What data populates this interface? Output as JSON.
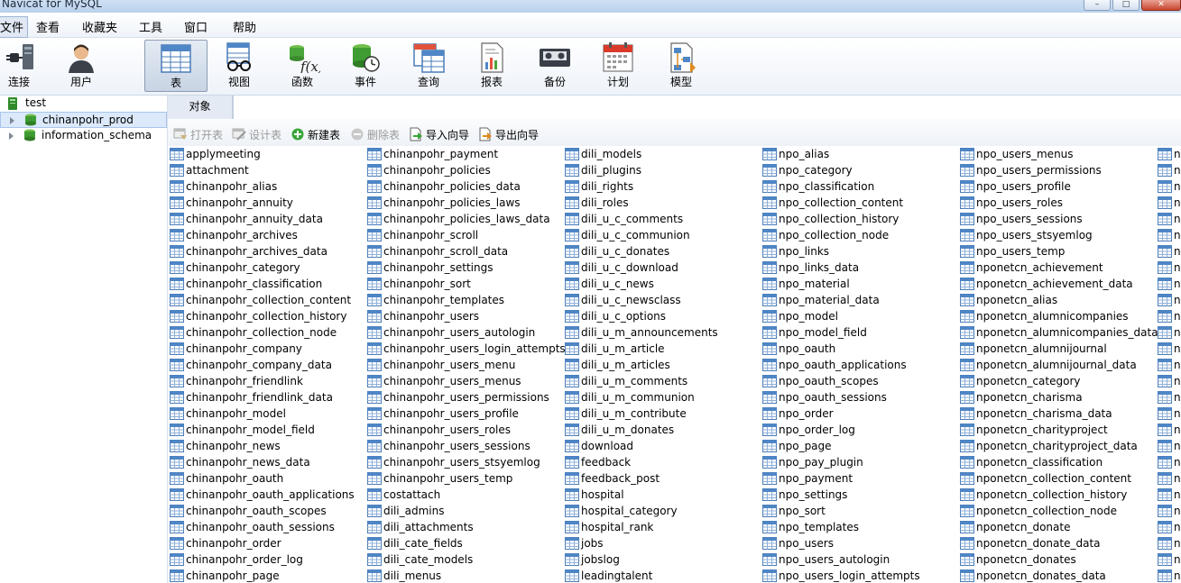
{
  "window": {
    "title": "Navicat for MySQL"
  },
  "menubar": [
    "文件",
    "查看",
    "收藏夹",
    "工具",
    "窗口",
    "帮助"
  ],
  "toolbar": [
    {
      "label": "连接",
      "icon": "connection-plug-icon"
    },
    {
      "label": "用户",
      "icon": "user-icon"
    },
    {
      "label": "表",
      "icon": "table-icon",
      "active": true
    },
    {
      "label": "视图",
      "icon": "view-glasses-icon"
    },
    {
      "label": "函数",
      "icon": "function-icon"
    },
    {
      "label": "事件",
      "icon": "event-clock-icon"
    },
    {
      "label": "查询",
      "icon": "query-icon"
    },
    {
      "label": "报表",
      "icon": "report-icon"
    },
    {
      "label": "备份",
      "icon": "backup-tape-icon"
    },
    {
      "label": "计划",
      "icon": "schedule-calendar-icon"
    },
    {
      "label": "模型",
      "icon": "model-icon"
    }
  ],
  "tree": [
    {
      "label": "test",
      "level": 0
    },
    {
      "label": "chinanpohr_prod",
      "level": 1,
      "selected": true
    },
    {
      "label": "information_schema",
      "level": 1
    }
  ],
  "tabs": {
    "objects": "对象"
  },
  "object_toolbar": [
    {
      "label": "打开表",
      "disabled": true,
      "icon": "open-table-icon"
    },
    {
      "label": "设计表",
      "disabled": true,
      "icon": "design-table-icon"
    },
    {
      "label": "新建表",
      "disabled": false,
      "icon": "new-table-icon"
    },
    {
      "label": "删除表",
      "disabled": true,
      "icon": "delete-table-icon"
    },
    {
      "label": "导入向导",
      "disabled": false,
      "icon": "import-wizard-icon"
    },
    {
      "label": "导出向导",
      "disabled": false,
      "icon": "export-wizard-icon"
    }
  ],
  "tables": [
    [
      "applymeeting",
      "attachment",
      "chinanpohr_alias",
      "chinanpohr_annuity",
      "chinanpohr_annuity_data",
      "chinanpohr_archives",
      "chinanpohr_archives_data",
      "chinanpohr_category",
      "chinanpohr_classification",
      "chinanpohr_collection_content",
      "chinanpohr_collection_history",
      "chinanpohr_collection_node",
      "chinanpohr_company",
      "chinanpohr_company_data",
      "chinanpohr_friendlink",
      "chinanpohr_friendlink_data",
      "chinanpohr_model",
      "chinanpohr_model_field",
      "chinanpohr_news",
      "chinanpohr_news_data",
      "chinanpohr_oauth",
      "chinanpohr_oauth_applications",
      "chinanpohr_oauth_scopes",
      "chinanpohr_oauth_sessions",
      "chinanpohr_order",
      "chinanpohr_order_log",
      "chinanpohr_page"
    ],
    [
      "chinanpohr_payment",
      "chinanpohr_policies",
      "chinanpohr_policies_data",
      "chinanpohr_policies_laws",
      "chinanpohr_policies_laws_data",
      "chinanpohr_scroll",
      "chinanpohr_scroll_data",
      "chinanpohr_settings",
      "chinanpohr_sort",
      "chinanpohr_templates",
      "chinanpohr_users",
      "chinanpohr_users_autologin",
      "chinanpohr_users_login_attempts",
      "chinanpohr_users_menu",
      "chinanpohr_users_menus",
      "chinanpohr_users_permissions",
      "chinanpohr_users_profile",
      "chinanpohr_users_roles",
      "chinanpohr_users_sessions",
      "chinanpohr_users_stsyemlog",
      "chinanpohr_users_temp",
      "costattach",
      "dili_admins",
      "dili_attachments",
      "dili_cate_fields",
      "dili_cate_models",
      "dili_menus"
    ],
    [
      "dili_models",
      "dili_plugins",
      "dili_rights",
      "dili_roles",
      "dili_u_c_comments",
      "dili_u_c_communion",
      "dili_u_c_donates",
      "dili_u_c_download",
      "dili_u_c_news",
      "dili_u_c_newsclass",
      "dili_u_c_options",
      "dili_u_m_announcements",
      "dili_u_m_article",
      "dili_u_m_articles",
      "dili_u_m_comments",
      "dili_u_m_communion",
      "dili_u_m_contribute",
      "dili_u_m_donates",
      "download",
      "feedback",
      "feedback_post",
      "hospital",
      "hospital_category",
      "hospital_rank",
      "jobs",
      "jobslog",
      "leadingtalent"
    ],
    [
      "npo_alias",
      "npo_category",
      "npo_classification",
      "npo_collection_content",
      "npo_collection_history",
      "npo_collection_node",
      "npo_links",
      "npo_links_data",
      "npo_material",
      "npo_material_data",
      "npo_model",
      "npo_model_field",
      "npo_oauth",
      "npo_oauth_applications",
      "npo_oauth_scopes",
      "npo_oauth_sessions",
      "npo_order",
      "npo_order_log",
      "npo_page",
      "npo_pay_plugin",
      "npo_payment",
      "npo_settings",
      "npo_sort",
      "npo_templates",
      "npo_users",
      "npo_users_autologin",
      "npo_users_login_attempts"
    ],
    [
      "npo_users_menus",
      "npo_users_permissions",
      "npo_users_profile",
      "npo_users_roles",
      "npo_users_sessions",
      "npo_users_stsyemlog",
      "npo_users_temp",
      "nponetcn_achievement",
      "nponetcn_achievement_data",
      "nponetcn_alias",
      "nponetcn_alumnicompanies",
      "nponetcn_alumnicompanies_data",
      "nponetcn_alumnijournal",
      "nponetcn_alumnijournal_data",
      "nponetcn_category",
      "nponetcn_charisma",
      "nponetcn_charisma_data",
      "nponetcn_charityproject",
      "nponetcn_charityproject_data",
      "nponetcn_classification",
      "nponetcn_collection_content",
      "nponetcn_collection_history",
      "nponetcn_collection_node",
      "nponetcn_donate",
      "nponetcn_donate_data",
      "nponetcn_donates",
      "nponetcn_donates_data"
    ],
    [
      "n",
      "n",
      "n",
      "n",
      "n",
      "n",
      "n",
      "n",
      "n",
      "n",
      "n",
      "n",
      "n",
      "n",
      "n",
      "n",
      "n",
      "n",
      "n",
      "n",
      "n",
      "n",
      "n",
      "n",
      "n",
      "n",
      "n"
    ]
  ]
}
